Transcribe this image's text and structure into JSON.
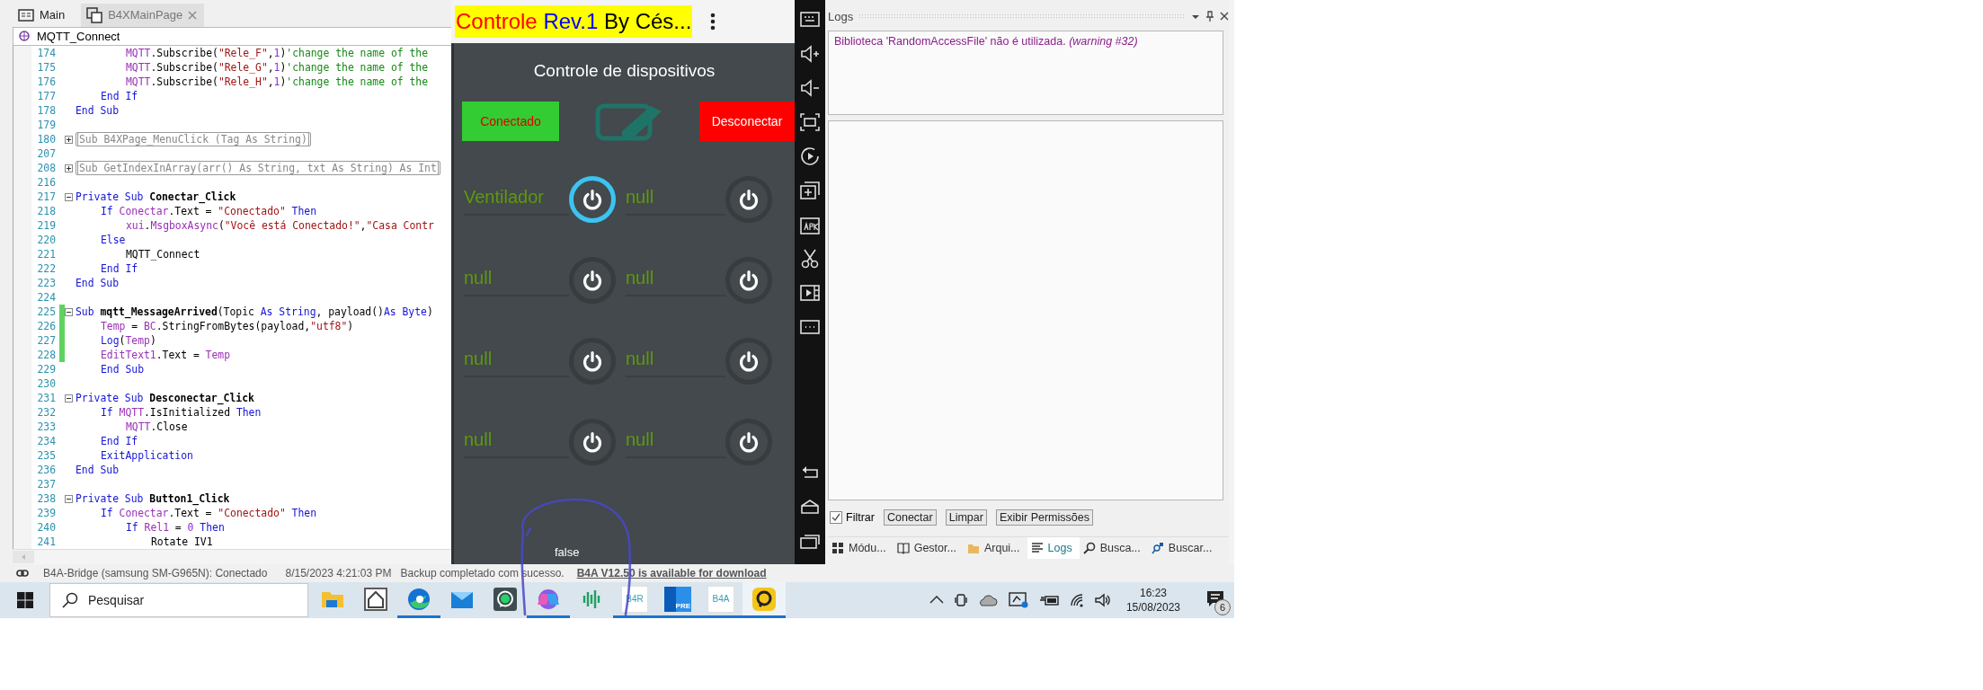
{
  "editor": {
    "tabs": [
      {
        "label": "Main",
        "selected": false,
        "closable": false
      },
      {
        "label": "B4XMainPage",
        "selected": true,
        "closable": true
      }
    ],
    "sub_selector": "MQTT_Connect",
    "lines": [
      {
        "children": [
          {
            "children": [
              {
                "number": "174",
                "changed": false,
                "foldable": false,
                "tokens": [
                  {
                    "kind": "identifier",
                    "text": "MQTT"
                  },
                  {
                    "kind": "plain",
                    "text": ".Subscribe("
                  },
                  {
                    "kind": "string",
                    "text": "\"Rele_F\""
                  },
                  {
                    "kind": "plain",
                    "text": ","
                  },
                  {
                    "kind": "number",
                    "text": "1"
                  },
                  {
                    "kind": "plain",
                    "text": ")"
                  },
                  {
                    "kind": "comment",
                    "text": "'change the name of the"
                  }
                ]
              },
              {
                "number": "175",
                "changed": false,
                "foldable": false,
                "tokens": [
                  {
                    "kind": "identifier",
                    "text": "MQTT"
                  },
                  {
                    "kind": "plain",
                    "text": ".Subscribe("
                  },
                  {
                    "kind": "string",
                    "text": "\"Rele_G\""
                  },
                  {
                    "kind": "plain",
                    "text": ","
                  },
                  {
                    "kind": "number",
                    "text": "1"
                  },
                  {
                    "kind": "plain",
                    "text": ")"
                  },
                  {
                    "kind": "comment",
                    "text": "'change the name of the"
                  }
                ]
              },
              {
                "number": "176",
                "changed": false,
                "foldable": false,
                "tokens": [
                  {
                    "kind": "identifier",
                    "text": "MQTT"
                  },
                  {
                    "kind": "plain",
                    "text": ".Subscribe("
                  },
                  {
                    "kind": "string",
                    "text": "\"Rele_H\""
                  },
                  {
                    "kind": "plain",
                    "text": ","
                  },
                  {
                    "kind": "number",
                    "text": "1"
                  },
                  {
                    "kind": "plain",
                    "text": ")"
                  },
                  {
                    "kind": "comment",
                    "text": "'change the name of the"
                  }
                ]
              }
            ]
          },
          {
            "number": "177",
            "changed": false,
            "foldable": false,
            "tokens": [
              {
                "kind": "keyword",
                "text": "End If"
              }
            ]
          }
        ]
      },
      {
        "number": "178",
        "changed": false,
        "foldable": false,
        "tokens": [
          {
            "kind": "keyword",
            "text": "End Sub"
          }
        ]
      },
      {
        "number": "179",
        "changed": false,
        "foldable": false
      },
      {
        "number": "180",
        "changed": false,
        "foldable": true,
        "collapsed": true,
        "tokens": [
          {
            "kind": "folded",
            "text": "Sub B4XPage_MenuClick (Tag As String)"
          }
        ]
      },
      {
        "number": "207",
        "changed": false,
        "foldable": false
      },
      {
        "number": "208",
        "changed": false,
        "foldable": true,
        "collapsed": true,
        "tokens": [
          {
            "kind": "folded",
            "text": "Sub GetIndexInArray(arr() As String, txt As String) As Int"
          }
        ]
      },
      {
        "number": "216",
        "changed": false,
        "foldable": false
      },
      {
        "number": "217",
        "changed": false,
        "foldable": true,
        "collapsed": false,
        "tokens": [
          {
            "kind": "keyword",
            "text": "Private Sub "
          },
          {
            "kind": "name",
            "text": "Conectar_Click"
          }
        ],
        "children": [
          {
            "number": "218",
            "changed": false,
            "foldable": false,
            "tokens": [
              {
                "kind": "keyword",
                "text": "If "
              },
              {
                "kind": "identifier",
                "text": "Conectar"
              },
              {
                "kind": "plain",
                "text": ".Text = "
              },
              {
                "kind": "string",
                "text": "\"Conectado\""
              },
              {
                "kind": "keyword",
                "text": " Then"
              }
            ],
            "children": [
              {
                "number": "219",
                "changed": false,
                "foldable": false,
                "tokens": [
                  {
                    "kind": "identifier",
                    "text": "xui"
                  },
                  {
                    "kind": "plain",
                    "text": "."
                  },
                  {
                    "kind": "identifier",
                    "text": "MsgboxAsync"
                  },
                  {
                    "kind": "plain",
                    "text": "("
                  },
                  {
                    "kind": "string",
                    "text": "\"Você está Conectado!\""
                  },
                  {
                    "kind": "plain",
                    "text": ","
                  },
                  {
                    "kind": "string",
                    "text": "\"Casa Contr"
                  }
                ]
              }
            ]
          },
          {
            "number": "220",
            "changed": false,
            "foldable": false,
            "tokens": [
              {
                "kind": "keyword",
                "text": "Else"
              }
            ],
            "children": [
              {
                "number": "221",
                "changed": false,
                "foldable": false,
                "tokens": [
                  {
                    "kind": "plain",
                    "text": "MQTT_Connect"
                  }
                ]
              }
            ]
          },
          {
            "number": "222",
            "changed": false,
            "foldable": false,
            "tokens": [
              {
                "kind": "keyword",
                "text": "End If"
              }
            ]
          }
        ]
      },
      {
        "number": "223",
        "changed": false,
        "foldable": false,
        "tokens": [
          {
            "kind": "keyword",
            "text": "End Sub"
          }
        ]
      },
      {
        "number": "224",
        "changed": false,
        "foldable": false
      },
      {
        "number": "225",
        "changed": true,
        "foldable": true,
        "collapsed": false,
        "tokens": [
          {
            "kind": "keyword",
            "text": "Sub "
          },
          {
            "kind": "name",
            "text": "mqtt_MessageArrived"
          },
          {
            "kind": "plain",
            "text": "(Topic "
          },
          {
            "kind": "keyword",
            "text": "As String"
          },
          {
            "kind": "plain",
            "text": ", payload()"
          },
          {
            "kind": "keyword",
            "text": "As Byte"
          },
          {
            "kind": "plain",
            "text": ")"
          }
        ],
        "children": [
          {
            "number": "226",
            "changed": true,
            "foldable": false,
            "tokens": [
              {
                "kind": "identifier",
                "text": "Temp"
              },
              {
                "kind": "plain",
                "text": " = "
              },
              {
                "kind": "identifier",
                "text": "BC"
              },
              {
                "kind": "plain",
                "text": ".StringFromBytes(payload,"
              },
              {
                "kind": "string",
                "text": "\"utf8\""
              },
              {
                "kind": "plain",
                "text": ")"
              }
            ]
          },
          {
            "number": "227",
            "changed": true,
            "foldable": false,
            "tokens": [
              {
                "kind": "keyword",
                "text": "Log"
              },
              {
                "kind": "plain",
                "text": "("
              },
              {
                "kind": "identifier",
                "text": "Temp"
              },
              {
                "kind": "plain",
                "text": ")"
              }
            ]
          },
          {
            "number": "228",
            "changed": true,
            "foldable": false,
            "tokens": [
              {
                "kind": "identifier",
                "text": "EditText1"
              },
              {
                "kind": "plain",
                "text": ".Text = "
              },
              {
                "kind": "identifier",
                "text": "Temp"
              }
            ]
          },
          {
            "number": "229",
            "changed": false,
            "foldable": false,
            "tokens": [
              {
                "kind": "keyword",
                "text": "End Sub"
              }
            ]
          }
        ]
      },
      {
        "number": "230",
        "changed": false,
        "foldable": false
      },
      {
        "number": "231",
        "changed": false,
        "foldable": true,
        "collapsed": false,
        "tokens": [
          {
            "kind": "keyword",
            "text": "Private Sub "
          },
          {
            "kind": "name",
            "text": "Desconectar_Click"
          }
        ],
        "children": [
          {
            "number": "232",
            "changed": false,
            "foldable": false,
            "tokens": [
              {
                "kind": "keyword",
                "text": "If "
              },
              {
                "kind": "identifier",
                "text": "MQTT"
              },
              {
                "kind": "plain",
                "text": ".IsInitialized"
              },
              {
                "kind": "keyword",
                "text": " Then"
              }
            ],
            "children": [
              {
                "number": "233",
                "changed": false,
                "foldable": false,
                "tokens": [
                  {
                    "kind": "identifier",
                    "text": "MQTT"
                  },
                  {
                    "kind": "plain",
                    "text": ".Close"
                  }
                ]
              }
            ]
          },
          {
            "number": "234",
            "changed": false,
            "foldable": false,
            "tokens": [
              {
                "kind": "keyword",
                "text": "End If"
              }
            ]
          },
          {
            "number": "235",
            "changed": false,
            "foldable": false,
            "tokens": [
              {
                "kind": "keyword",
                "text": "ExitApplication"
              }
            ]
          }
        ]
      },
      {
        "number": "236",
        "changed": false,
        "foldable": false,
        "tokens": [
          {
            "kind": "keyword",
            "text": "End Sub"
          }
        ]
      },
      {
        "number": "237",
        "changed": false,
        "foldable": false
      },
      {
        "number": "238",
        "changed": false,
        "foldable": true,
        "collapsed": false,
        "tokens": [
          {
            "kind": "keyword",
            "text": "Private Sub "
          },
          {
            "kind": "name",
            "text": "Button1_Click"
          }
        ],
        "children": [
          {
            "number": "239",
            "changed": false,
            "foldable": false,
            "tokens": [
              {
                "kind": "keyword",
                "text": "If "
              },
              {
                "kind": "identifier",
                "text": "Conectar"
              },
              {
                "kind": "plain",
                "text": ".Text = "
              },
              {
                "kind": "string",
                "text": "\"Conectado\""
              },
              {
                "kind": "keyword",
                "text": " Then"
              }
            ],
            "children": [
              {
                "number": "240",
                "changed": false,
                "foldable": false,
                "tokens": [
                  {
                    "kind": "keyword",
                    "text": "If "
                  },
                  {
                    "kind": "identifier",
                    "text": "Rel1"
                  },
                  {
                    "kind": "plain",
                    "text": " = "
                  },
                  {
                    "kind": "number",
                    "text": "0"
                  },
                  {
                    "kind": "keyword",
                    "text": " Then"
                  }
                ],
                "children": [
                  {
                    "number": "241",
                    "changed": false,
                    "foldable": false,
                    "tokens": [
                      {
                        "kind": "plain",
                        "text": "Rotate IV1"
                      }
                    ]
                  }
                ]
              }
            ]
          }
        ]
      }
    ]
  },
  "phone": {
    "app_title": [
      {
        "text": "Controle ",
        "color": "#ff0000"
      },
      {
        "text": "Rev.1 ",
        "color": "#0000ff"
      },
      {
        "text": "By Cés...",
        "color": "#000000"
      }
    ],
    "heading": "Controle de dispositivos",
    "connect_button": "Conectado",
    "disconnect_button": "Desconectar",
    "devices": [
      {
        "label": "Ventilador",
        "focused": true
      },
      {
        "label": "null",
        "focused": false
      },
      {
        "label": "null",
        "focused": false
      },
      {
        "label": "null",
        "focused": false
      },
      {
        "label": "null",
        "focused": false
      },
      {
        "label": "null",
        "focused": false
      },
      {
        "label": "null",
        "focused": false
      },
      {
        "label": "null",
        "focused": false
      }
    ],
    "status_text": "false"
  },
  "logs": {
    "title": "Logs",
    "message": {
      "text": "Biblioteca 'RandomAccessFile' não é utilizada.",
      "note": "(warning #32)"
    },
    "filter": {
      "label": "Filtrar",
      "checked": true
    },
    "buttons": [
      "Conectar",
      "Limpar",
      "Exibir Permissões"
    ],
    "tabs": [
      {
        "label": "Módu...",
        "kind": "modules",
        "selected": false
      },
      {
        "label": "Gestor...",
        "kind": "book",
        "selected": false
      },
      {
        "label": "Arqui...",
        "kind": "folder",
        "selected": false
      },
      {
        "label": "Logs",
        "kind": "logs",
        "selected": true
      },
      {
        "label": "Busca...",
        "kind": "search",
        "selected": false
      },
      {
        "label": "Buscar...",
        "kind": "replace",
        "selected": false
      }
    ]
  },
  "status_bar": {
    "bridge": "B4A-Bridge (samsung SM-G965N): Conectado",
    "timestamp": "8/15/2023 4:21:03 PM",
    "message": "Backup completado com sucesso.",
    "update_link": "B4A V12.50 is available for download"
  },
  "taskbar": {
    "search_placeholder": "Pesquisar",
    "apps": [
      {
        "kind": "folder",
        "running": false,
        "selected": false
      },
      {
        "kind": "house",
        "running": false,
        "selected": false
      },
      {
        "kind": "edge",
        "running": true,
        "selected": false
      },
      {
        "kind": "mail",
        "running": false,
        "selected": false
      },
      {
        "kind": "whatsapp",
        "running": false,
        "selected": false
      },
      {
        "kind": "copilot",
        "running": true,
        "selected": false
      },
      {
        "kind": "wave",
        "running": false,
        "selected": false
      },
      {
        "kind": "tile",
        "text": "B4R",
        "running": true,
        "selected": false
      },
      {
        "kind": "outlook",
        "text": "PRE",
        "running": true,
        "selected": false
      },
      {
        "kind": "tile",
        "text": "B4A",
        "running": true,
        "selected": false
      },
      {
        "kind": "player",
        "running": true,
        "selected": true
      }
    ],
    "time": "16:23",
    "date": "15/08/2023",
    "notifications": "6"
  }
}
